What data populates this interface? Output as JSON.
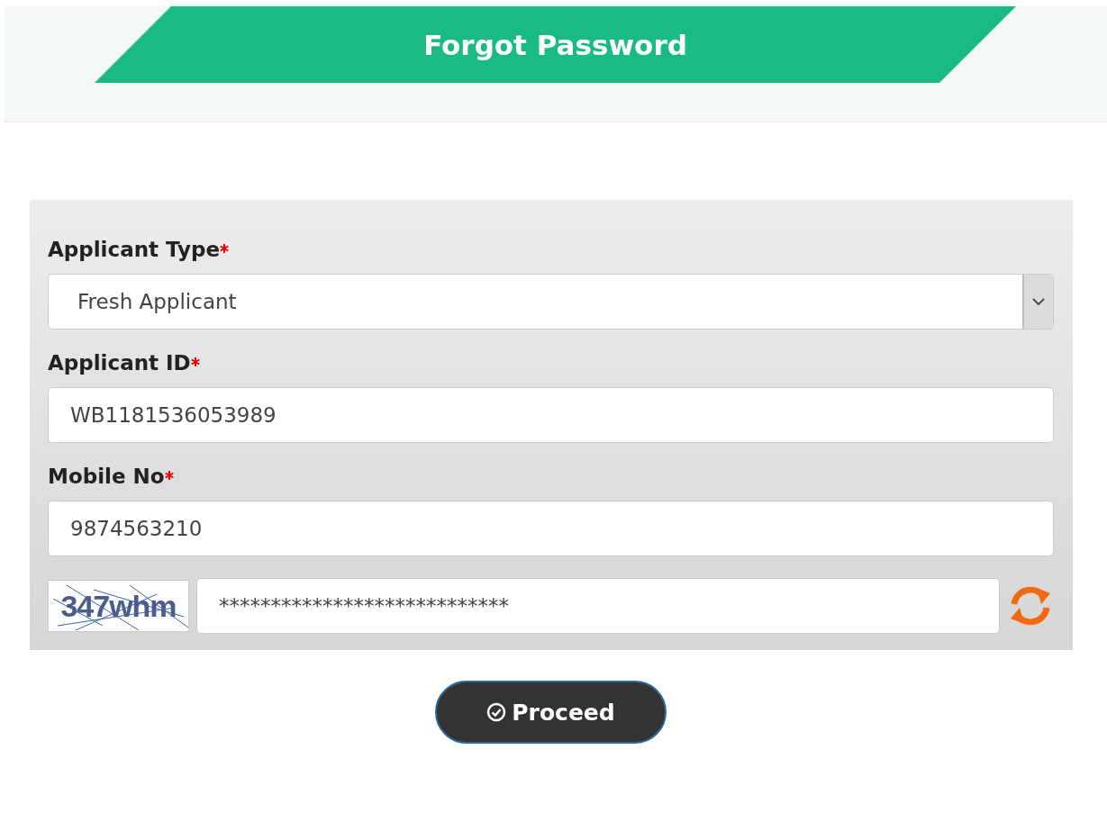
{
  "header": {
    "title": "Forgot Password"
  },
  "fields": [
    {
      "kind": "select",
      "label": "Applicant Type",
      "required": true,
      "value": "Fresh Applicant"
    },
    {
      "kind": "text",
      "label": "Applicant ID",
      "required": true,
      "value": "WB1181536053989"
    },
    {
      "kind": "text",
      "label": "Mobile No",
      "required": true,
      "value": "9874563210"
    }
  ],
  "captcha": {
    "image_text": "347whm",
    "value": "****************************"
  },
  "button": {
    "label": "Proceed"
  }
}
